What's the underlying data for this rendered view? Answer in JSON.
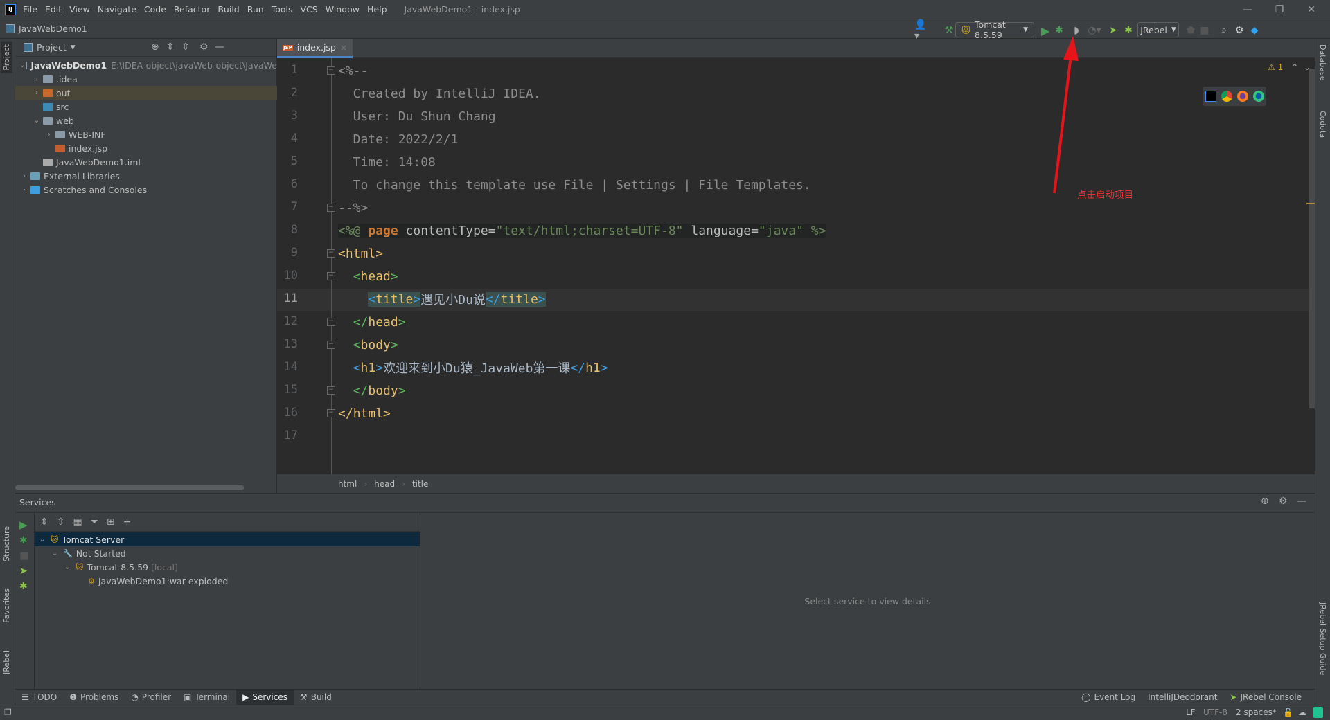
{
  "menubar": {
    "items": [
      "File",
      "Edit",
      "View",
      "Navigate",
      "Code",
      "Refactor",
      "Build",
      "Run",
      "Tools",
      "VCS",
      "Window",
      "Help"
    ],
    "window_title": "JavaWebDemo1 - index.jsp"
  },
  "navbar": {
    "project": "JavaWebDemo1",
    "run_config": "Tomcat 8.5.59",
    "jrebel": "JRebel"
  },
  "left_strip": {
    "project": "Project",
    "structure": "Structure",
    "favorites": "Favorites",
    "jrebel": "JRebel"
  },
  "right_strip": {
    "database": "Database",
    "codota": "Codota",
    "jrebel_guide": "JRebel Setup Guide"
  },
  "project_panel": {
    "title": "Project",
    "tree": [
      {
        "label": "JavaWebDemo1",
        "path": "E:\\IDEA-object\\javaWeb-object\\JavaWe",
        "depth": 0,
        "chev": "v",
        "icon": "module",
        "bold": true
      },
      {
        "label": ".idea",
        "depth": 1,
        "chev": ">",
        "icon": "folder"
      },
      {
        "label": "out",
        "depth": 1,
        "chev": ">",
        "icon": "folder-orange",
        "selected": true
      },
      {
        "label": "src",
        "depth": 1,
        "chev": "",
        "icon": "folder-blue"
      },
      {
        "label": "web",
        "depth": 1,
        "chev": "v",
        "icon": "folder-web"
      },
      {
        "label": "WEB-INF",
        "depth": 2,
        "chev": ">",
        "icon": "folder"
      },
      {
        "label": "index.jsp",
        "depth": 2,
        "chev": "",
        "icon": "jsp"
      },
      {
        "label": "JavaWebDemo1.iml",
        "depth": 1,
        "chev": "",
        "icon": "file"
      },
      {
        "label": "External Libraries",
        "depth": 0,
        "chev": ">",
        "icon": "libs"
      },
      {
        "label": "Scratches and Consoles",
        "depth": 0,
        "chev": ">",
        "icon": "scratch"
      }
    ]
  },
  "editor": {
    "tab": "index.jsp",
    "current_line": 11,
    "warnings": "1",
    "lines": [
      [
        [
          "<%--",
          "t-cmt"
        ]
      ],
      [
        [
          "  Created by IntelliJ IDEA.",
          "t-cmt"
        ]
      ],
      [
        [
          "  User: Du Shun Chang",
          "t-cmt"
        ]
      ],
      [
        [
          "  Date: 2022/2/1",
          "t-cmt"
        ]
      ],
      [
        [
          "  Time: 14:08",
          "t-cmt"
        ]
      ],
      [
        [
          "  To change this template use File | Settings | File Templates.",
          "t-cmt"
        ]
      ],
      [
        [
          "--%>",
          "t-cmt"
        ]
      ],
      [
        [
          "<%@ ",
          "t-dir d8"
        ],
        [
          "page ",
          "t-kw d8"
        ],
        [
          "contentType=",
          "t-attr d8"
        ],
        [
          "\"text/html;charset=UTF-8\"",
          "t-str d8"
        ],
        [
          " language=",
          "t-attr d8"
        ],
        [
          "\"java\"",
          "t-str d8"
        ],
        [
          " %>",
          "t-dir d8"
        ]
      ],
      [
        [
          "<",
          "t-tagy"
        ],
        [
          "html",
          "t-tagy"
        ],
        [
          ">",
          "t-tagy"
        ]
      ],
      [
        [
          "  ",
          "t-txt"
        ],
        [
          "<",
          "t-bg"
        ],
        [
          "head",
          "t-tagy"
        ],
        [
          ">",
          "t-bg"
        ]
      ],
      [
        [
          "    ",
          "t-txt"
        ],
        [
          "<",
          "t-bb hl"
        ],
        [
          "title",
          "t-tagy hl"
        ],
        [
          ">",
          "t-bb hl"
        ],
        [
          "遇见小Du说",
          "t-txt"
        ],
        [
          "</",
          "t-bb hl"
        ],
        [
          "title",
          "t-tagy hl"
        ],
        [
          ">",
          "t-bb hl"
        ]
      ],
      [
        [
          "  ",
          "t-txt"
        ],
        [
          "</",
          "t-bg"
        ],
        [
          "head",
          "t-tagy"
        ],
        [
          ">",
          "t-bg"
        ]
      ],
      [
        [
          "  ",
          "t-txt"
        ],
        [
          "<",
          "t-bg"
        ],
        [
          "body",
          "t-tagy"
        ],
        [
          ">",
          "t-bg"
        ]
      ],
      [
        [
          "  ",
          "t-txt"
        ],
        [
          "<",
          "t-bb"
        ],
        [
          "h1",
          "t-tagy"
        ],
        [
          ">",
          "t-bb"
        ],
        [
          "欢迎来到小Du猿_JavaWeb第一课",
          "t-txt"
        ],
        [
          "</",
          "t-bb"
        ],
        [
          "h1",
          "t-tagy"
        ],
        [
          ">",
          "t-bb"
        ]
      ],
      [
        [
          "  ",
          "t-txt"
        ],
        [
          "</",
          "t-bg"
        ],
        [
          "body",
          "t-tagy"
        ],
        [
          ">",
          "t-bg"
        ]
      ],
      [
        [
          "</",
          "t-tagy"
        ],
        [
          "html",
          "t-tagy"
        ],
        [
          ">",
          "t-tagy"
        ]
      ],
      []
    ],
    "breadcrumbs": [
      "html",
      "head",
      "title"
    ]
  },
  "annotation": {
    "text": "点击启动项目",
    "color": "#e53333"
  },
  "services": {
    "title": "Services",
    "tree": [
      {
        "label": "Tomcat Server",
        "depth": 0,
        "chev": "v",
        "selected": true
      },
      {
        "label": "Not Started",
        "depth": 1,
        "chev": "v"
      },
      {
        "label": "Tomcat 8.5.59",
        "suffix": "[local]",
        "depth": 2,
        "chev": "v"
      },
      {
        "label": "JavaWebDemo1:war exploded",
        "depth": 3,
        "chev": ""
      }
    ],
    "empty_text": "Select service to view details"
  },
  "bottom_tabs": [
    {
      "label": "TODO",
      "icon": "☰"
    },
    {
      "label": "Problems",
      "icon": "❶"
    },
    {
      "label": "Profiler",
      "icon": "◔"
    },
    {
      "label": "Terminal",
      "icon": "▣"
    },
    {
      "label": "Services",
      "icon": "▶",
      "active": true
    },
    {
      "label": "Build",
      "icon": "⚒"
    }
  ],
  "right_tabs": [
    "Event Log",
    "IntelliJDeodorant",
    "JRebel Console"
  ],
  "status": {
    "line_sep": "LF",
    "encoding": "UTF-8",
    "indent": "2 spaces*"
  },
  "colors": {
    "accent": "#4a88c7",
    "run_green": "#499c54",
    "selection": "#0d293e"
  }
}
